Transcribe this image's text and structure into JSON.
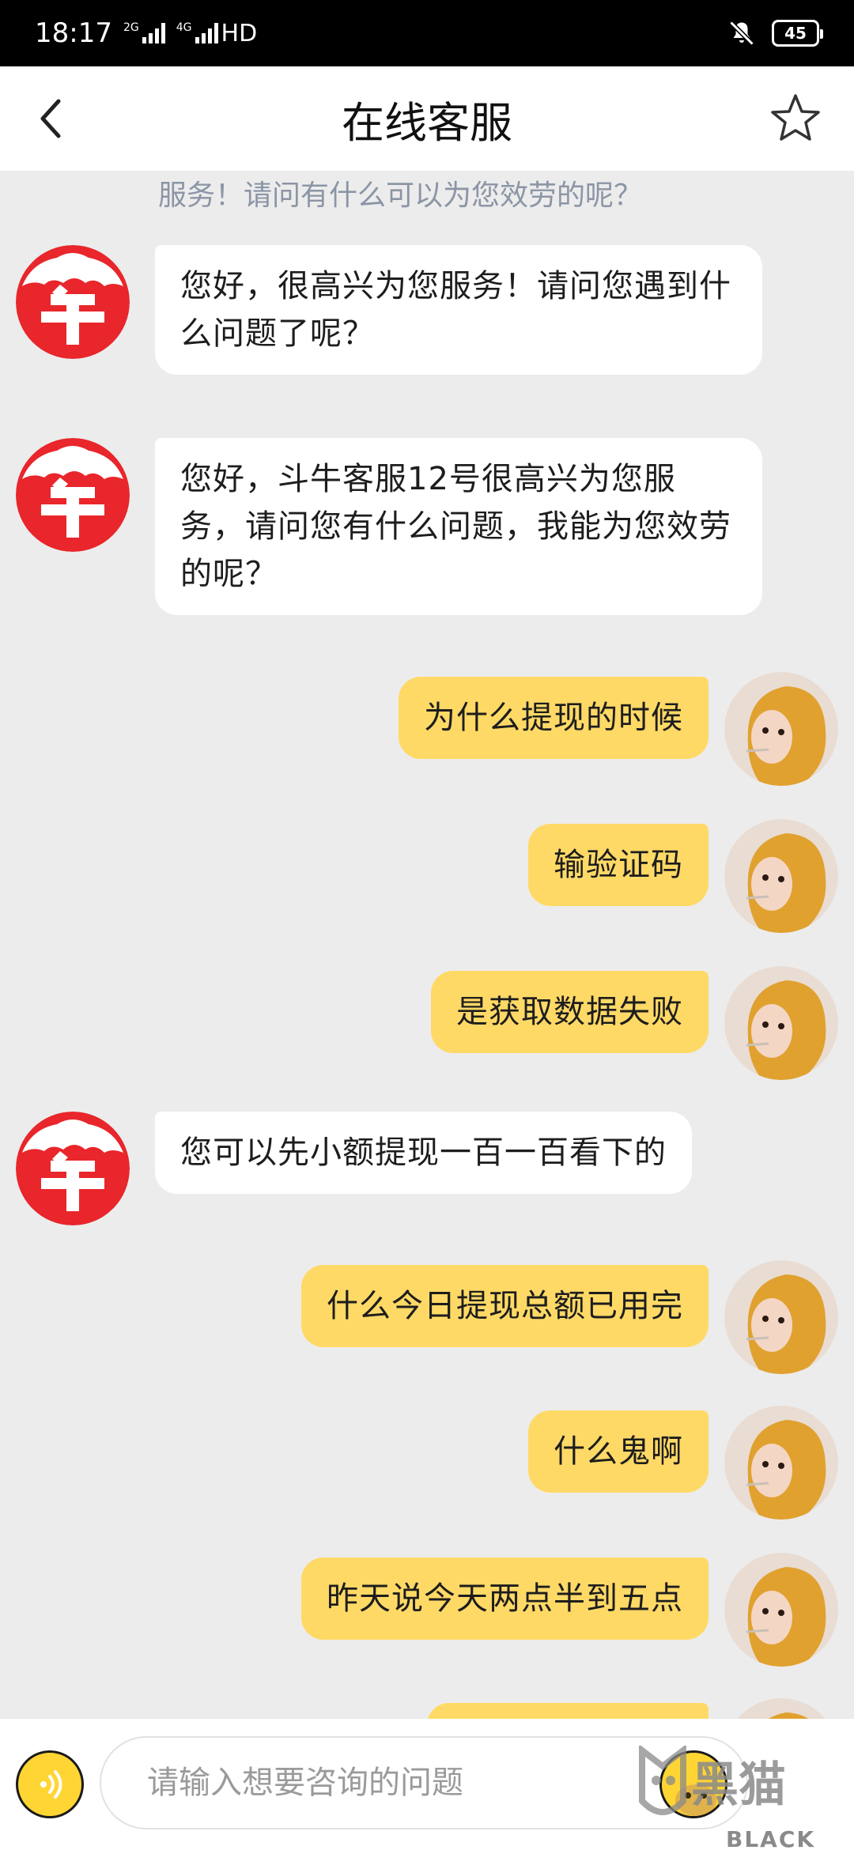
{
  "status_bar": {
    "time": "18:17",
    "net1": "2G",
    "net2": "4G",
    "hd": "HD",
    "battery": "45"
  },
  "header": {
    "title": "在线客服"
  },
  "chat": {
    "faded_text": "服务！请问有什么可以为您效劳的呢？",
    "messages": [
      {
        "side": "left",
        "text": "您好，很高兴为您服务！请问您遇到什么问题了呢？"
      },
      {
        "side": "left",
        "text": "您好，斗牛客服12号很高兴为您服务，请问您有什么问题，我能为您效劳的呢？"
      },
      {
        "side": "right",
        "text": "为什么提现的时候"
      },
      {
        "side": "right",
        "text": "输验证码"
      },
      {
        "side": "right",
        "text": "是获取数据失败"
      },
      {
        "side": "left",
        "text": "您可以先小额提现一百一百看下的"
      },
      {
        "side": "right",
        "text": "什么今日提现总额已用完"
      },
      {
        "side": "right",
        "text": "什么鬼啊"
      },
      {
        "side": "right",
        "text": "昨天说今天两点半到五点"
      }
    ]
  },
  "input": {
    "placeholder": "请输入想要咨询的问题"
  },
  "watermark": {
    "text": "BLACK CAT",
    "glyph": "黑猫"
  },
  "colors": {
    "accent": "#ffd966",
    "logo_red": "#e8262b",
    "background": "#ececec"
  },
  "icons": [
    "back-icon",
    "star-icon",
    "voice-icon",
    "emoji-icon",
    "logo-icon"
  ]
}
